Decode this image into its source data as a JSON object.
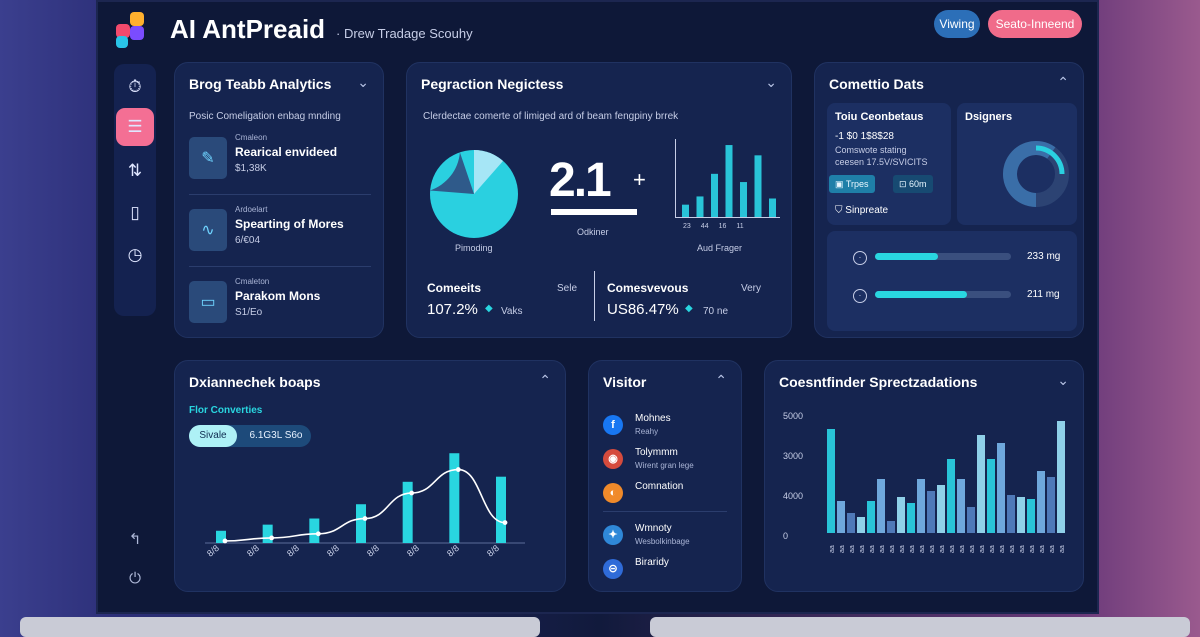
{
  "header": {
    "title": "AI AntPreaid",
    "subtitle": "· Drew Tradage Scouhy",
    "view_label": "Viwing",
    "start_label": "Seato-Inneend",
    "logo_colors": [
      "#f24a6c",
      "#ffb02e",
      "#7a4cff",
      "#29c4e8"
    ]
  },
  "rail": {
    "items": [
      {
        "icon": "timer-icon",
        "glyph": "⏱"
      },
      {
        "icon": "menu-icon",
        "glyph": "☰"
      },
      {
        "icon": "sort-icon",
        "glyph": "⇅"
      },
      {
        "icon": "phone-icon",
        "glyph": "▯"
      },
      {
        "icon": "clock-icon",
        "glyph": "◷"
      }
    ],
    "bottom": [
      {
        "icon": "share-icon",
        "glyph": "↰"
      },
      {
        "icon": "power-icon",
        "glyph": "⏻"
      }
    ]
  },
  "panel1": {
    "title": "Brog Teabb Analytics",
    "subtitle": "Posic Comeligation enbag mnding",
    "items": [
      {
        "caption": "Cmaleon",
        "name": "Rearical envideed",
        "value": "$1,38K",
        "glyph": "✎"
      },
      {
        "caption": "Ardoelart",
        "name": "Spearting of Mores",
        "value": "6/€04",
        "glyph": "∿"
      },
      {
        "caption": "Cmaleton",
        "name": "Parakom Mons",
        "value": "S1/Eo",
        "glyph": "▭"
      }
    ]
  },
  "panel2": {
    "title": "Pegraction Negictess",
    "description": "Clerdectae comerte of limiged ard of beam fengpiny brrek",
    "pie_caption": "Pimoding",
    "big_number": "2.1",
    "big_plus": "+",
    "big_caption": "Odkiner",
    "mini_caption": "Aud Frager",
    "mini_ticks": [
      "23",
      "44",
      "16",
      "11"
    ],
    "mini_values": [
      12,
      20,
      42,
      70,
      34,
      60,
      18
    ],
    "metric1": {
      "label": "Comeeits",
      "right": "Sele",
      "value": "107.2%",
      "small": "Vaks"
    },
    "metric2": {
      "label": "Comesvevous",
      "right": "Very",
      "value": "US86.47%",
      "small": "70 ne"
    }
  },
  "panel3": {
    "title": "Comettio Dats",
    "card_a": {
      "title": "Toiu Ceonbetaus",
      "line1": "-1 $0 1$8$28",
      "line2": "Comswote stating",
      "line3": "ceesen 17.5V/SVICITS",
      "chip1": "Trpes",
      "chip2": "60m",
      "footer": "Sinpreate"
    },
    "card_b": {
      "title": "Dsigners",
      "gauge_percent": 60
    },
    "progress": [
      {
        "fraction": 0.46,
        "label": "233 mg"
      },
      {
        "fraction": 0.68,
        "label": "211 mg"
      }
    ]
  },
  "panel4": {
    "title": "Dxiannechek boaps",
    "subtitle": "Flor Converties",
    "seg_a": "Sivale",
    "seg_b": "6.1G3L S6o",
    "chart_data": {
      "type": "bar",
      "categories": [
        "d1",
        "d2",
        "d3",
        "d4",
        "d5",
        "d6",
        "d7"
      ],
      "values": [
        12,
        18,
        24,
        38,
        60,
        88,
        65
      ],
      "line_values": [
        2,
        5,
        9,
        24,
        49,
        72,
        20
      ],
      "ylim": [
        0,
        100
      ]
    },
    "xlabels": [
      "8/8",
      "8/8",
      "8/8",
      "8/8",
      "8/8",
      "8/8",
      "8/8",
      "8/8"
    ]
  },
  "panel5": {
    "title": "Visitor",
    "items": [
      {
        "icon": "facebook-icon",
        "glyph": "f",
        "color": "#1877f2",
        "name": "Mohnes",
        "sub": "Reahy"
      },
      {
        "icon": "instagram-icon",
        "glyph": "◉",
        "color": "#d54b3d",
        "name": "Tolymmm",
        "sub": "Wirent gran lege"
      },
      {
        "icon": "compass-icon",
        "glyph": "◐",
        "color": "#f08a2a",
        "name": "Comnation",
        "sub": ""
      },
      {
        "icon": "twitter-icon",
        "glyph": "✦",
        "color": "#2f88d8",
        "name": "Wmnoty",
        "sub": "Wesbolkinbage"
      },
      {
        "icon": "link-icon",
        "glyph": "⊝",
        "color": "#2f6bd8",
        "name": "Biraridy",
        "sub": ""
      }
    ]
  },
  "panel6": {
    "title": "Coesntfinder Sprectzadations",
    "yticks": [
      "5000",
      "3000",
      "4000",
      "0"
    ],
    "chart_data": {
      "type": "bar",
      "values": [
        52,
        16,
        10,
        8,
        16,
        27,
        6,
        18,
        15,
        27,
        21,
        24,
        37,
        27,
        13,
        49,
        37,
        45,
        19,
        18,
        17,
        31,
        28,
        56
      ],
      "colors": [
        "#29c4d8",
        "#6fa8dc",
        "#4f79b8",
        "#8fd0e8"
      ],
      "ylim": [
        0,
        60
      ]
    },
    "xlabels": [
      "aa",
      "aa",
      "aa",
      "aa",
      "aa",
      "aa",
      "aa",
      "aa",
      "aa",
      "aa",
      "aa",
      "aa",
      "aa",
      "aa",
      "aa",
      "aa",
      "aa",
      "aa",
      "aa",
      "aa",
      "aa",
      "aa",
      "aa",
      "aa"
    ]
  }
}
